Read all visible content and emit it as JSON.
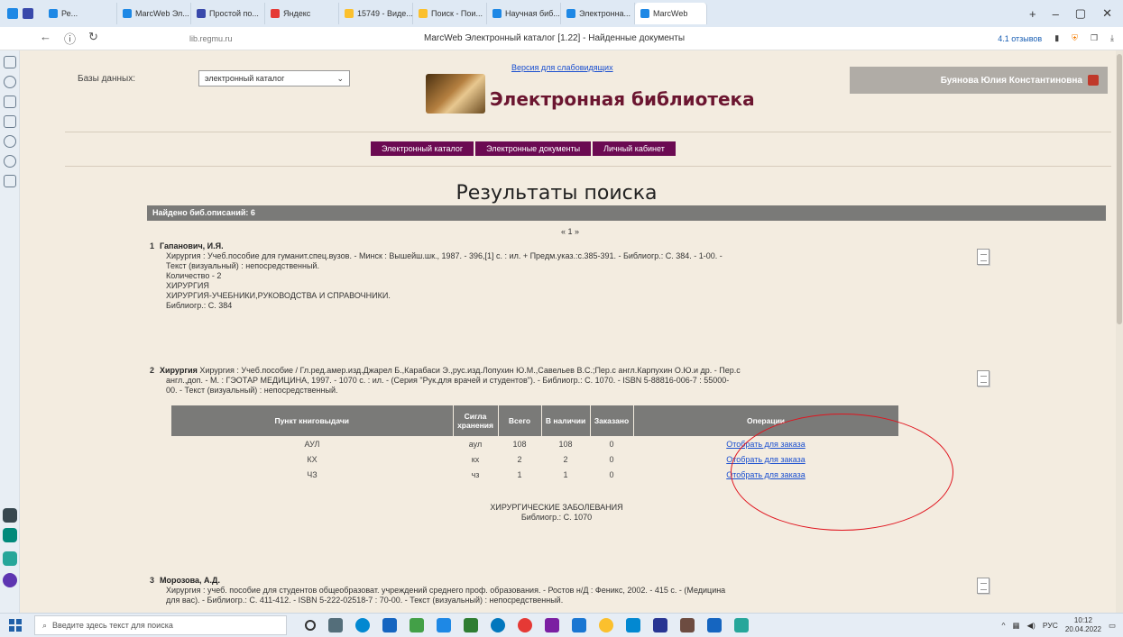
{
  "browser": {
    "tabs": [
      {
        "label": "Ре...",
        "color": "#1e88e5",
        "active": false
      },
      {
        "label": "MarcWeb Эл...",
        "color": "#1e88e5",
        "active": false
      },
      {
        "label": "Простой по...",
        "color": "#3949ab",
        "active": false
      },
      {
        "label": "Яндекс",
        "color": "#e53935",
        "active": false
      },
      {
        "label": "15749 - Виде...",
        "color": "#fbc02d",
        "active": false
      },
      {
        "label": "Поиск - Пои...",
        "color": "#fbc02d",
        "active": false
      },
      {
        "label": "Научная биб...",
        "color": "#1e88e5",
        "active": false
      },
      {
        "label": "Электронна...",
        "color": "#1e88e5",
        "active": false
      },
      {
        "label": "MarcWeb",
        "color": "#1e88e5",
        "active": true
      }
    ],
    "url": "lib.regmu.ru",
    "page_title": "MarcWeb Электронный каталог [1.22] - Найденные документы",
    "reviews": "4.1 отзывов"
  },
  "page": {
    "db_label": "Базы данных:",
    "db_value": "электронный каталог",
    "weak_vision_link": "Версия для слабовидящих",
    "library_title": "Электронная библиотека",
    "user_name": "Буянова Юлия Константиновна",
    "nav": [
      "Электронный каталог",
      "Электронные документы",
      "Личный кабинет"
    ],
    "results_title": "Результаты поиска",
    "found_text": "Найдено биб.описаний: 6",
    "pager": "« 1 »",
    "records": [
      {
        "num": "1",
        "author": "Гапанович, И.Я.",
        "lines": [
          "Хирургия : Учеб.пособие для гуманит.спец.вузов. - Минск : Вышейш.шк., 1987. - 396,[1] с. : ил. + Предм.указ.:с.385-391. - Библиогр.: С. 384. - 1-00. -",
          "Текст (визуальный) : непосредственный.",
          "Количество - 2",
          "ХИРУРГИЯ",
          "ХИРУРГИЯ-УЧЕБНИКИ,РУКОВОДСТВА И СПРАВОЧНИКИ.",
          "Библиогр.: С. 384"
        ]
      },
      {
        "num": "2",
        "title": "Хирургия",
        "lines": [
          "Хирургия : Учеб.пособие / Гл.ред.амер.изд.Джарел Б.,Карабаси Э.,рус.изд.Лопухин Ю.М.,Савельев В.С.;Пер.с англ.Карпухин О.Ю.и др. - Пер.с",
          "англ.,доп. - М. : ГЭОТАР МЕДИЦИНА, 1997. - 1070 с. : ил. - (Серия \"Рук.для врачей и студентов\"). - Библиогр.: С. 1070. - ISBN 5-88816-006-7 : 55000-",
          "00. - Текст (визуальный) : непосредственный."
        ],
        "table": {
          "headers": [
            "Пункт книговыдачи",
            "Сигла хранения",
            "Всего",
            "В наличии",
            "Заказано",
            "Операции"
          ],
          "rows": [
            [
              "АУЛ",
              "аул",
              "108",
              "108",
              "0",
              "Отобрать для заказа"
            ],
            [
              "КХ",
              "кх",
              "2",
              "2",
              "0",
              "Отобрать для заказа"
            ],
            [
              "ЧЗ",
              "чз",
              "1",
              "1",
              "0",
              "Отобрать для заказа"
            ]
          ]
        },
        "subject": "ХИРУРГИЧЕСКИЕ ЗАБОЛЕВАНИЯ",
        "biblio": "Библиогр.: С. 1070"
      },
      {
        "num": "3",
        "author": "Морозова, А.Д.",
        "lines": [
          "Хирургия : учеб. пособие для студентов общеобразоват. учреждений среднего проф. образования. - Ростов н/Д : Феникс, 2002. - 415 с. - (Медицина",
          "для вас). - Библиогр.: С. 411-412. - ISBN 5-222-02518-7 : 70-00. - Текст (визуальный) : непосредственный."
        ]
      }
    ]
  },
  "taskbar": {
    "search_placeholder": "Введите здесь текст для поиска",
    "lang": "РУС",
    "time": "10:12",
    "date": "20.04.2022"
  },
  "colors": {
    "page_bg": "#f3ece0",
    "nav_bg": "#6b0a52",
    "title": "#6b1530",
    "header_gray": "#7a7a78",
    "annotation": "#e0141e"
  }
}
